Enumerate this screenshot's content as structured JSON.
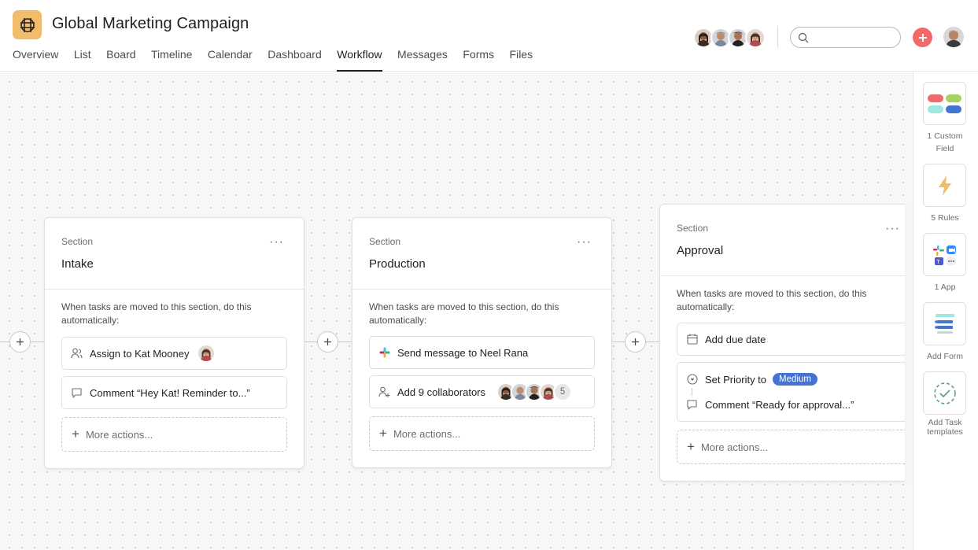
{
  "project": {
    "title": "Global Marketing Campaign",
    "icon": "grid-globe-icon",
    "icon_color": "#f1bd6c"
  },
  "tabs": [
    {
      "label": "Overview"
    },
    {
      "label": "List"
    },
    {
      "label": "Board"
    },
    {
      "label": "Timeline"
    },
    {
      "label": "Calendar"
    },
    {
      "label": "Dashboard"
    },
    {
      "label": "Workflow",
      "active": true
    },
    {
      "label": "Messages"
    },
    {
      "label": "Forms"
    },
    {
      "label": "Files"
    }
  ],
  "search": {
    "placeholder": ""
  },
  "colors": {
    "accent": "#f06a6a",
    "pill": "#4573d2",
    "project_icon": "#f1bd6c"
  },
  "sections": [
    {
      "label": "Section",
      "name": "Intake",
      "instructions": "When tasks are moved to this section, do this automatically:",
      "actions": [
        {
          "icon": "assign-person-icon",
          "text": "Assign to Kat Mooney"
        },
        {
          "icon": "comment-icon",
          "text": "Comment “Hey Kat! Reminder to...”"
        }
      ],
      "more": "More actions..."
    },
    {
      "label": "Section",
      "name": "Production",
      "instructions": "When tasks are moved to this section, do this automatically:",
      "actions": [
        {
          "icon": "slack-icon",
          "text": "Send message to Neel Rana"
        },
        {
          "icon": "add-collaborators-icon",
          "text": "Add 9 collaborators",
          "extra_count": "5"
        }
      ],
      "more": "More actions..."
    },
    {
      "label": "Section",
      "name": "Approval",
      "instructions": "When tasks are moved to this section, do this automatically:",
      "actions": [
        {
          "icon": "calendar-icon",
          "text": "Add due date"
        },
        {
          "icon": "priority-icon",
          "text": "Set Priority to",
          "pill": "Medium"
        },
        {
          "icon": "comment-icon",
          "text": "Comment “Ready for approval...”"
        }
      ],
      "more": "More actions..."
    }
  ],
  "right_panel": [
    {
      "icon": "custom-field-icon",
      "label": "1 Custom Field"
    },
    {
      "icon": "lightning-icon",
      "label": "5 Rules"
    },
    {
      "icon": "apps-icon",
      "label": "1 App"
    },
    {
      "icon": "form-icon",
      "label": "Add Form"
    },
    {
      "icon": "task-template-icon",
      "label": "Add Task templates"
    }
  ]
}
